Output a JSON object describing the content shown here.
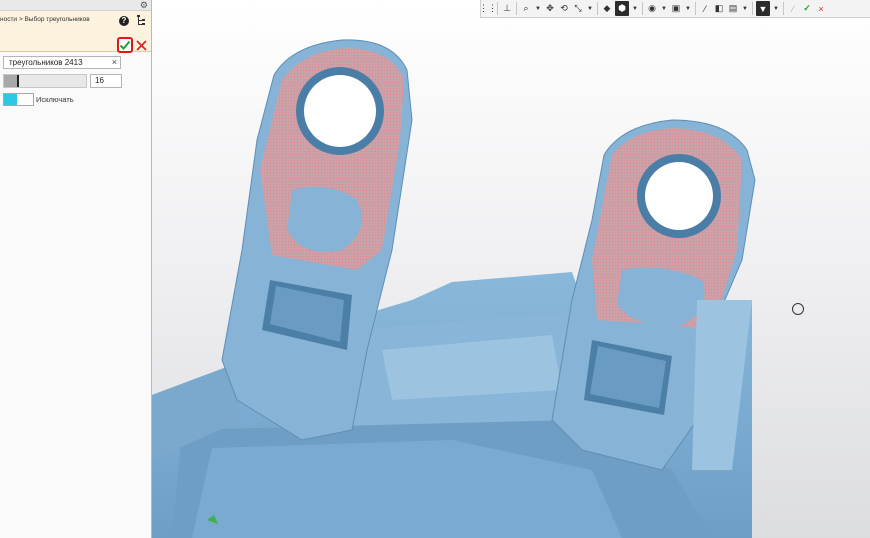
{
  "panel": {
    "breadcrumb": "ности > Выбор треугольников",
    "help_glyph": "?",
    "settings_glyph": "⚙",
    "selection_field": {
      "value": "треугольников 2413",
      "clear_glyph": "×"
    },
    "slider": {
      "value": "16",
      "fill_fraction": 0.16
    },
    "exclude": {
      "label": "Исключать",
      "checked": true
    }
  },
  "toolbar": {
    "items": [
      "grid-icon",
      "axes-icon",
      "zoom-icon",
      "pan-icon",
      "rotate-icon",
      "align-icon",
      "shape-icon",
      "solid-icon",
      "visibility-icon",
      "view-icon",
      "sections-icon",
      "color-icon",
      "display-icon",
      "filter-icon",
      "pick-icon",
      "ok-icon"
    ]
  },
  "colors": {
    "accent_ok": "#1aa33a",
    "cancel": "#e02020",
    "highlight_border": "#e01818",
    "model": "#7fb0d4",
    "selection": "#d59a9f",
    "toggle_on": "#2ec8e6"
  }
}
